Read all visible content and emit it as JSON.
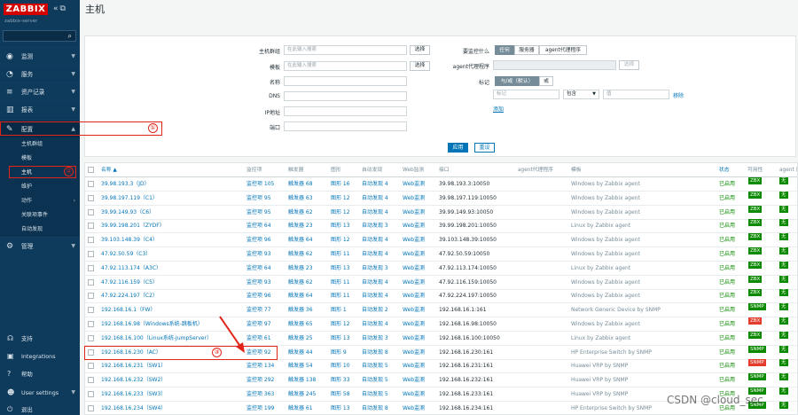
{
  "sidebar": {
    "logo": "ZABBIX",
    "server_name": "zabbix-server",
    "menu": [
      {
        "label": "监测",
        "icon": "eye-icon"
      },
      {
        "label": "服务",
        "icon": "clock-icon"
      },
      {
        "label": "资产记录",
        "icon": "list-icon"
      },
      {
        "label": "报表",
        "icon": "bar-chart-icon"
      },
      {
        "label": "配置",
        "icon": "wrench-icon"
      }
    ],
    "submenu": [
      "主机群组",
      "模板",
      "主机",
      "维护",
      "动作",
      "关联项事件",
      "自动发现"
    ],
    "admin_label": "管理",
    "footer": [
      "支持",
      "Integrations",
      "帮助",
      "User settings",
      "退出"
    ]
  },
  "header": {
    "title": "主机"
  },
  "filter": {
    "host_groups_label": "主机群组",
    "templates_label": "模板",
    "name_label": "名称",
    "dns_label": "DNS",
    "ip_label": "IP地址",
    "port_label": "端口",
    "search_placeholder": "在此输入搜索",
    "select_label": "选择",
    "monitored_by_label": "要监控什么",
    "monitored_by_options": [
      "任何",
      "服务器",
      "agent代理程序"
    ],
    "proxy_label": "agent代理程序",
    "tags_label": "标记",
    "tag_mode_options": [
      "与/或（默认）",
      "或"
    ],
    "tag_placeholder": "标记",
    "tag_operator": "包含",
    "value_placeholder": "值",
    "remove_label": "移除",
    "add_label": "添加",
    "apply_label": "应用",
    "reset_label": "重设"
  },
  "table": {
    "headers": [
      "名称 ▲",
      "监控项",
      "触发器",
      "图形",
      "自动发现",
      "Web监测",
      "接口",
      "agent代理程序",
      "模板",
      "状态",
      "可用性",
      "agent 加"
    ],
    "rows": [
      {
        "name": "39.98.193.3（JD）",
        "items": "监控项 105",
        "triggers": "触发器 68",
        "graphs": "图形 16",
        "discovery": "自动发现 4",
        "web": "Web监测",
        "iface": "39.98.193.3:10050",
        "template": "Windows by Zabbix agent",
        "status": "已启用",
        "avail": "ZBX",
        "avail_color": "green",
        "enc": "无"
      },
      {
        "name": "39.98.197.119（C1）",
        "items": "监控项 95",
        "triggers": "触发器 63",
        "graphs": "图形 12",
        "discovery": "自动发现 4",
        "web": "Web监测",
        "iface": "39.98.197.119:10050",
        "template": "Windows by Zabbix agent",
        "status": "已启用",
        "avail": "ZBX",
        "avail_color": "green",
        "enc": "无"
      },
      {
        "name": "39.99.149.93（C6）",
        "items": "监控项 95",
        "triggers": "触发器 62",
        "graphs": "图形 12",
        "discovery": "自动发现 4",
        "web": "Web监测",
        "iface": "39.99.149.93:10050",
        "template": "Windows by Zabbix agent",
        "status": "已启用",
        "avail": "ZBX",
        "avail_color": "green",
        "enc": "无"
      },
      {
        "name": "39.99.198.201（ZYDF）",
        "items": "监控项 64",
        "triggers": "触发器 23",
        "graphs": "图形 13",
        "discovery": "自动发现 3",
        "web": "Web监测",
        "iface": "39.99.198.201:10050",
        "template": "Linux by Zabbix agent",
        "status": "已启用",
        "avail": "ZBX",
        "avail_color": "green",
        "enc": "无"
      },
      {
        "name": "39.103.148.39（C4）",
        "items": "监控项 96",
        "triggers": "触发器 64",
        "graphs": "图形 12",
        "discovery": "自动发现 4",
        "web": "Web监测",
        "iface": "39.103.148.39:10050",
        "template": "Windows by Zabbix agent",
        "status": "已启用",
        "avail": "ZBX",
        "avail_color": "green",
        "enc": "无"
      },
      {
        "name": "47.92.50.59（C3）",
        "items": "监控项 93",
        "triggers": "触发器 62",
        "graphs": "图形 11",
        "discovery": "自动发现 4",
        "web": "Web监测",
        "iface": "47.92.50.59:10050",
        "template": "Windows by Zabbix agent",
        "status": "已启用",
        "avail": "ZBX",
        "avail_color": "green",
        "enc": "无"
      },
      {
        "name": "47.92.113.174（A3C）",
        "items": "监控项 64",
        "triggers": "触发器 23",
        "graphs": "图形 13",
        "discovery": "自动发现 3",
        "web": "Web监测",
        "iface": "47.92.113.174:10050",
        "template": "Linux by Zabbix agent",
        "status": "已启用",
        "avail": "ZBX",
        "avail_color": "green",
        "enc": "无"
      },
      {
        "name": "47.92.116.159（C5）",
        "items": "监控项 93",
        "triggers": "触发器 62",
        "graphs": "图形 11",
        "discovery": "自动发现 4",
        "web": "Web监测",
        "iface": "47.92.116.159:10050",
        "template": "Windows by Zabbix agent",
        "status": "已启用",
        "avail": "ZBX",
        "avail_color": "green",
        "enc": "无"
      },
      {
        "name": "47.92.224.197（C2）",
        "items": "监控项 96",
        "triggers": "触发器 64",
        "graphs": "图形 11",
        "discovery": "自动发现 4",
        "web": "Web监测",
        "iface": "47.92.224.197:10050",
        "template": "Windows by Zabbix agent",
        "status": "已启用",
        "avail": "ZBX",
        "avail_color": "green",
        "enc": "无"
      },
      {
        "name": "192.168.16.1（FW）",
        "items": "监控项 77",
        "triggers": "触发器 36",
        "graphs": "图形 1",
        "discovery": "自动发现 2",
        "web": "Web监测",
        "iface": "192.168.16.1:161",
        "template": "Network Generic Device by SNMP",
        "status": "已启用",
        "avail": "SNMP",
        "avail_color": "green",
        "enc": "无"
      },
      {
        "name": "192.168.16.98（Windows系统-跳板机）",
        "items": "监控项 97",
        "triggers": "触发器 65",
        "graphs": "图形 12",
        "discovery": "自动发现 4",
        "web": "Web监测",
        "iface": "192.168.16.98:10050",
        "template": "Windows by Zabbix agent",
        "status": "已启用",
        "avail": "ZBX",
        "avail_color": "red",
        "enc": "无"
      },
      {
        "name": "192.168.16.100（Linux系统-JumpServer）",
        "items": "监控项 61",
        "triggers": "触发器 25",
        "graphs": "图形 13",
        "discovery": "自动发现 3",
        "web": "Web监测",
        "iface": "192.168.16.100:10050",
        "template": "Linux by Zabbix agent",
        "status": "已启用",
        "avail": "ZBX",
        "avail_color": "green",
        "enc": "无"
      },
      {
        "name": "192.168.16.230（AC）",
        "items": "监控项 92",
        "triggers": "触发器 44",
        "graphs": "图形 9",
        "discovery": "自动发现 8",
        "web": "Web监测",
        "iface": "192.168.16.230:161",
        "template": "HP Enterprise Switch by SNMP",
        "status": "已启用",
        "avail": "SNMP",
        "avail_color": "green",
        "enc": "无"
      },
      {
        "name": "192.168.16.231（SW1）",
        "items": "监控项 134",
        "triggers": "触发器 54",
        "graphs": "图形 10",
        "discovery": "自动发现 5",
        "web": "Web监测",
        "iface": "192.168.16.231:161",
        "template": "Huawei VRP by SNMP",
        "status": "已启用",
        "avail": "SNMP",
        "avail_color": "red",
        "enc": "无"
      },
      {
        "name": "192.168.16.232（SW2）",
        "items": "监控项 292",
        "triggers": "触发器 138",
        "graphs": "图形 33",
        "discovery": "自动发现 5",
        "web": "Web监测",
        "iface": "192.168.16.232:161",
        "template": "Huawei VRP by SNMP",
        "status": "已启用",
        "avail": "SNMP",
        "avail_color": "green",
        "enc": "无"
      },
      {
        "name": "192.168.16.233（SW3）",
        "items": "监控项 363",
        "triggers": "触发器 245",
        "graphs": "图形 58",
        "discovery": "自动发现 5",
        "web": "Web监测",
        "iface": "192.168.16.233:161",
        "template": "Huawei VRP by SNMP",
        "status": "已启用",
        "avail": "SNMP",
        "avail_color": "green",
        "enc": "无"
      },
      {
        "name": "192.168.16.234（SW4）",
        "items": "监控项 199",
        "triggers": "触发器 61",
        "graphs": "图形 13",
        "discovery": "自动发现 8",
        "web": "Web监测",
        "iface": "192.168.16.234:161",
        "template": "HP Enterprise Switch by SNMP",
        "status": "已启用",
        "avail": "SNMP",
        "avail_color": "green",
        "enc": "无"
      }
    ]
  },
  "annotations": {
    "one": "①",
    "two": "②",
    "three": "③"
  },
  "watermark": "CSDN @cloud_sec",
  "colors": {
    "sidebar": "#0e3a5c",
    "brand": "#d40000",
    "link": "#0275b8",
    "enabled": "#0b8a00",
    "error": "#e43b2d",
    "annotation": "#e2251b"
  }
}
